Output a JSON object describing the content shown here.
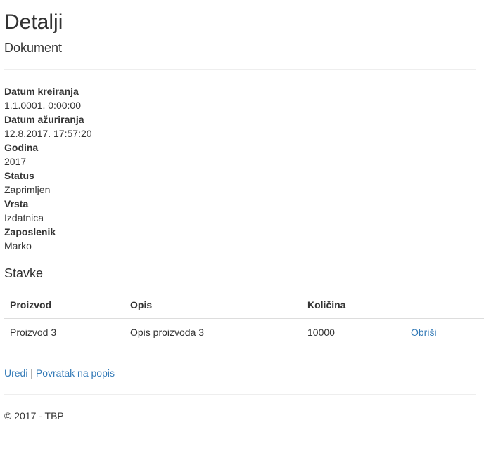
{
  "header": {
    "title": "Detalji",
    "subtitle": "Dokument"
  },
  "details": [
    {
      "label": "Datum kreiranja",
      "value": "1.1.0001. 0:00:00"
    },
    {
      "label": "Datum ažuriranja",
      "value": "12.8.2017. 17:57:20"
    },
    {
      "label": "Godina",
      "value": "2017"
    },
    {
      "label": "Status",
      "value": "Zaprimljen"
    },
    {
      "label": "Vrsta",
      "value": "Izdatnica"
    },
    {
      "label": "Zaposlenik",
      "value": "Marko"
    }
  ],
  "items_section": {
    "title": "Stavke",
    "columns": [
      "Proizvod",
      "Opis",
      "Količina",
      ""
    ],
    "rows": [
      {
        "product": "Proizvod 3",
        "description": "Opis proizvoda 3",
        "quantity": "10000",
        "delete_label": "Obriši"
      }
    ]
  },
  "actions": {
    "edit_label": "Uredi",
    "separator": "|",
    "back_label": "Povratak na popis"
  },
  "footer": {
    "text": "© 2017 - TBP"
  },
  "colors": {
    "link": "#337ab7",
    "text": "#333333",
    "divider": "#eeeeee"
  }
}
